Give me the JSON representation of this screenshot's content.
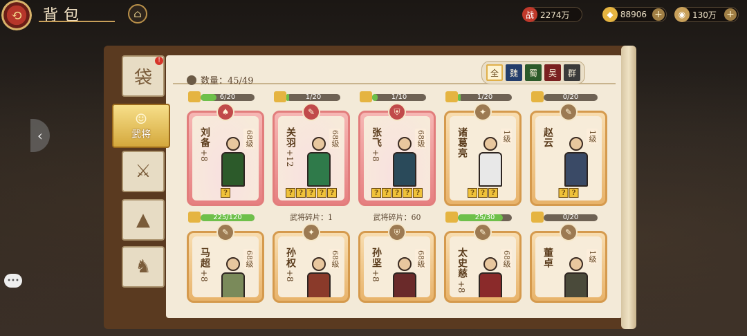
{
  "header": {
    "title": "背包",
    "back_icon": "back-icon",
    "home_icon": "home-icon"
  },
  "resources": [
    {
      "icon": "battle-power-icon",
      "glyph": "战",
      "value": "2274万",
      "color": "#c0392b",
      "has_plus": false
    },
    {
      "icon": "gold-ingot-icon",
      "glyph": "◆",
      "value": "88906",
      "color": "#e5b441",
      "has_plus": true
    },
    {
      "icon": "coin-icon",
      "glyph": "◉",
      "value": "130万",
      "color": "#c8a05a",
      "has_plus": true
    }
  ],
  "tabs": [
    {
      "id": "bag",
      "glyph": "袋",
      "label": ""
    },
    {
      "id": "heroes",
      "glyph": "☺",
      "label": "武将"
    },
    {
      "id": "weapons",
      "glyph": "⚔",
      "label": ""
    },
    {
      "id": "armor",
      "glyph": "▲",
      "label": ""
    },
    {
      "id": "mounts",
      "glyph": "♞",
      "label": ""
    }
  ],
  "count": {
    "label": "数量：45/49"
  },
  "factions": [
    {
      "label": "全",
      "color": "#fdf3d2",
      "active": true
    },
    {
      "label": "魏",
      "color": "#233d6b",
      "active": false
    },
    {
      "label": "蜀",
      "color": "#2c5a2a",
      "active": false
    },
    {
      "label": "吴",
      "color": "#7a2020",
      "active": false
    },
    {
      "label": "群",
      "color": "#3a3a3a",
      "active": false
    }
  ],
  "heroes": [
    {
      "name": "刘备",
      "plus": "+8",
      "level": "68级",
      "rarity": "red",
      "emblem": "♠",
      "stars": "?",
      "progress": "6/20",
      "progress_frac": 0.3,
      "fragment": "",
      "body_color": "#2c5a2a"
    },
    {
      "name": "关羽",
      "plus": "+12",
      "level": "68级",
      "rarity": "red",
      "emblem": "✎",
      "stars": "?????",
      "progress": "1/20",
      "progress_frac": 0.05,
      "fragment": "武将碎片：1",
      "body_color": "#2f7a4a"
    },
    {
      "name": "张飞",
      "plus": "+8",
      "level": "68级",
      "rarity": "red",
      "emblem": "⛨",
      "stars": "?????",
      "progress": "1/10",
      "progress_frac": 0.1,
      "fragment": "武将碎片：60",
      "body_color": "#2a4a5a"
    },
    {
      "name": "诸葛亮",
      "plus": "",
      "level": "1级",
      "rarity": "gold",
      "emblem": "✦",
      "stars": "???",
      "progress": "1/20",
      "progress_frac": 0.05,
      "fragment": "",
      "body_color": "#e8e8e8"
    },
    {
      "name": "赵云",
      "plus": "",
      "level": "1级",
      "rarity": "gold",
      "emblem": "✎",
      "stars": "??",
      "progress": "0/20",
      "progress_frac": 0.0,
      "fragment": "",
      "body_color": "#3a4a66"
    },
    {
      "name": "马超",
      "plus": "+8",
      "level": "68级",
      "rarity": "gold",
      "emblem": "✎",
      "stars": "",
      "progress": "225/120",
      "progress_frac": 1.0,
      "fragment": "",
      "body_color": "#7a8a5a"
    },
    {
      "name": "孙权",
      "plus": "+8",
      "level": "68级",
      "rarity": "gold",
      "emblem": "✦",
      "stars": "",
      "progress": "",
      "progress_frac": 0,
      "fragment": "",
      "body_color": "#8a3a2a"
    },
    {
      "name": "孙坚",
      "plus": "+8",
      "level": "68级",
      "rarity": "gold",
      "emblem": "⛨",
      "stars": "",
      "progress": "",
      "progress_frac": 0,
      "fragment": "",
      "body_color": "#6a2a2a"
    },
    {
      "name": "太史慈",
      "plus": "+8",
      "level": "68级",
      "rarity": "gold",
      "emblem": "✎",
      "stars": "",
      "progress": "25/30",
      "progress_frac": 0.83,
      "fragment": "",
      "body_color": "#8a2a2a"
    },
    {
      "name": "董卓",
      "plus": "",
      "level": "1级",
      "rarity": "gold",
      "emblem": "✎",
      "stars": "",
      "progress": "0/20",
      "progress_frac": 0.0,
      "fragment": "",
      "body_color": "#4a4a3a"
    }
  ]
}
